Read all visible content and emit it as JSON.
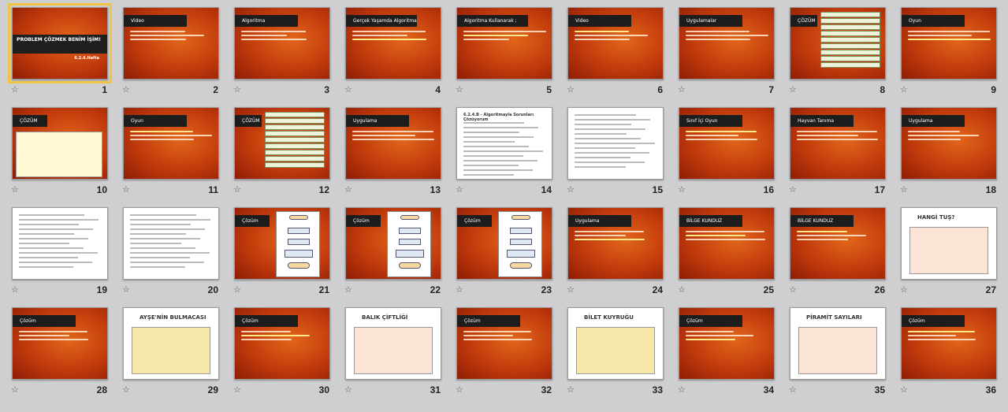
{
  "slides": [
    {
      "number": "1",
      "layout": "title",
      "title": "PROBLEM ÇÖZMEK BENİM İŞİM!",
      "subtitle": "6.2.4.Hafta",
      "selected": true
    },
    {
      "number": "2",
      "layout": "bullets",
      "title": "Video"
    },
    {
      "number": "3",
      "layout": "bullets",
      "title": "Algoritma"
    },
    {
      "number": "4",
      "layout": "bullets",
      "title": "Gerçek Yaşamda Algoritma"
    },
    {
      "number": "5",
      "layout": "bullets",
      "title": "Algoritma Kullanarak ;"
    },
    {
      "number": "6",
      "layout": "bullets",
      "title": "Video"
    },
    {
      "number": "7",
      "layout": "bullets",
      "title": "Uygulamalar"
    },
    {
      "number": "8",
      "layout": "boxes",
      "title": "ÇÖZÜM"
    },
    {
      "number": "9",
      "layout": "bullets",
      "title": "Oyun"
    },
    {
      "number": "10",
      "layout": "picture",
      "title": "ÇÖZÜM"
    },
    {
      "number": "11",
      "layout": "bullets",
      "title": "Oyun"
    },
    {
      "number": "12",
      "layout": "boxes",
      "title": "ÇÖZÜM"
    },
    {
      "number": "13",
      "layout": "bullets",
      "title": "Uygulama"
    },
    {
      "number": "14",
      "layout": "document",
      "title": "6.2.4.B - Algoritmayla Sorunları Çözüyorum"
    },
    {
      "number": "15",
      "layout": "document",
      "title": ""
    },
    {
      "number": "16",
      "layout": "bullets",
      "title": "Sınıf İçi Oyun"
    },
    {
      "number": "17",
      "layout": "bullets",
      "title": "Hayvan Tanıma"
    },
    {
      "number": "18",
      "layout": "bullets",
      "title": "Uygulama"
    },
    {
      "number": "19",
      "layout": "docpanel",
      "title": ""
    },
    {
      "number": "20",
      "layout": "document",
      "title": ""
    },
    {
      "number": "21",
      "layout": "flow",
      "title": "Çözüm"
    },
    {
      "number": "22",
      "layout": "flow",
      "title": "Çözüm"
    },
    {
      "number": "23",
      "layout": "flow",
      "title": "Çözüm"
    },
    {
      "number": "24",
      "layout": "bullets",
      "title": "Uygulama"
    },
    {
      "number": "25",
      "layout": "bullets",
      "title": "BİLGE KUNDUZ"
    },
    {
      "number": "26",
      "layout": "bullets",
      "title": "BİLGE KUNDUZ"
    },
    {
      "number": "27",
      "layout": "picture",
      "title": "HANGİ TUŞ?"
    },
    {
      "number": "28",
      "layout": "bullets",
      "title": "Çözüm"
    },
    {
      "number": "29",
      "layout": "picture",
      "title": "AYŞE'NİN BULMACASI"
    },
    {
      "number": "30",
      "layout": "bullets",
      "title": "Çözüm"
    },
    {
      "number": "31",
      "layout": "picture",
      "title": "BALIK ÇİFTLİĞİ"
    },
    {
      "number": "32",
      "layout": "bullets",
      "title": "Çözüm"
    },
    {
      "number": "33",
      "layout": "picture",
      "title": "BİLET KUYRUĞU"
    },
    {
      "number": "34",
      "layout": "bullets",
      "title": "Çözüm"
    },
    {
      "number": "35",
      "layout": "picture",
      "title": "PİRAMİT SAYILARI"
    },
    {
      "number": "36",
      "layout": "bullets",
      "title": "Çözüm"
    }
  ],
  "icons": {
    "star": "star-icon"
  }
}
